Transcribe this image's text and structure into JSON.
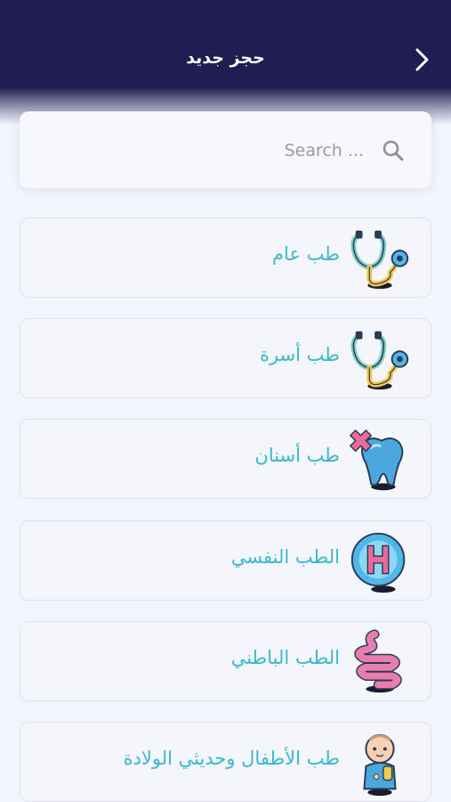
{
  "header": {
    "title": "حجز جديد"
  },
  "search": {
    "placeholder": "Search ..."
  },
  "specialties": [
    {
      "label": "طب عام",
      "icon": "stethoscope-icon"
    },
    {
      "label": "طب أسرة",
      "icon": "stethoscope-icon"
    },
    {
      "label": "طب أسنان",
      "icon": "tooth-icon"
    },
    {
      "label": "الطب النفسي",
      "icon": "hospital-h-icon"
    },
    {
      "label": "الطب الباطني",
      "icon": "intestine-icon"
    },
    {
      "label": "طب الأطفال وحديثي الولادة",
      "icon": "baby-icon"
    }
  ],
  "colors": {
    "header": "#201d52",
    "accent": "#3ab8cc",
    "background": "#f3f5fc"
  }
}
